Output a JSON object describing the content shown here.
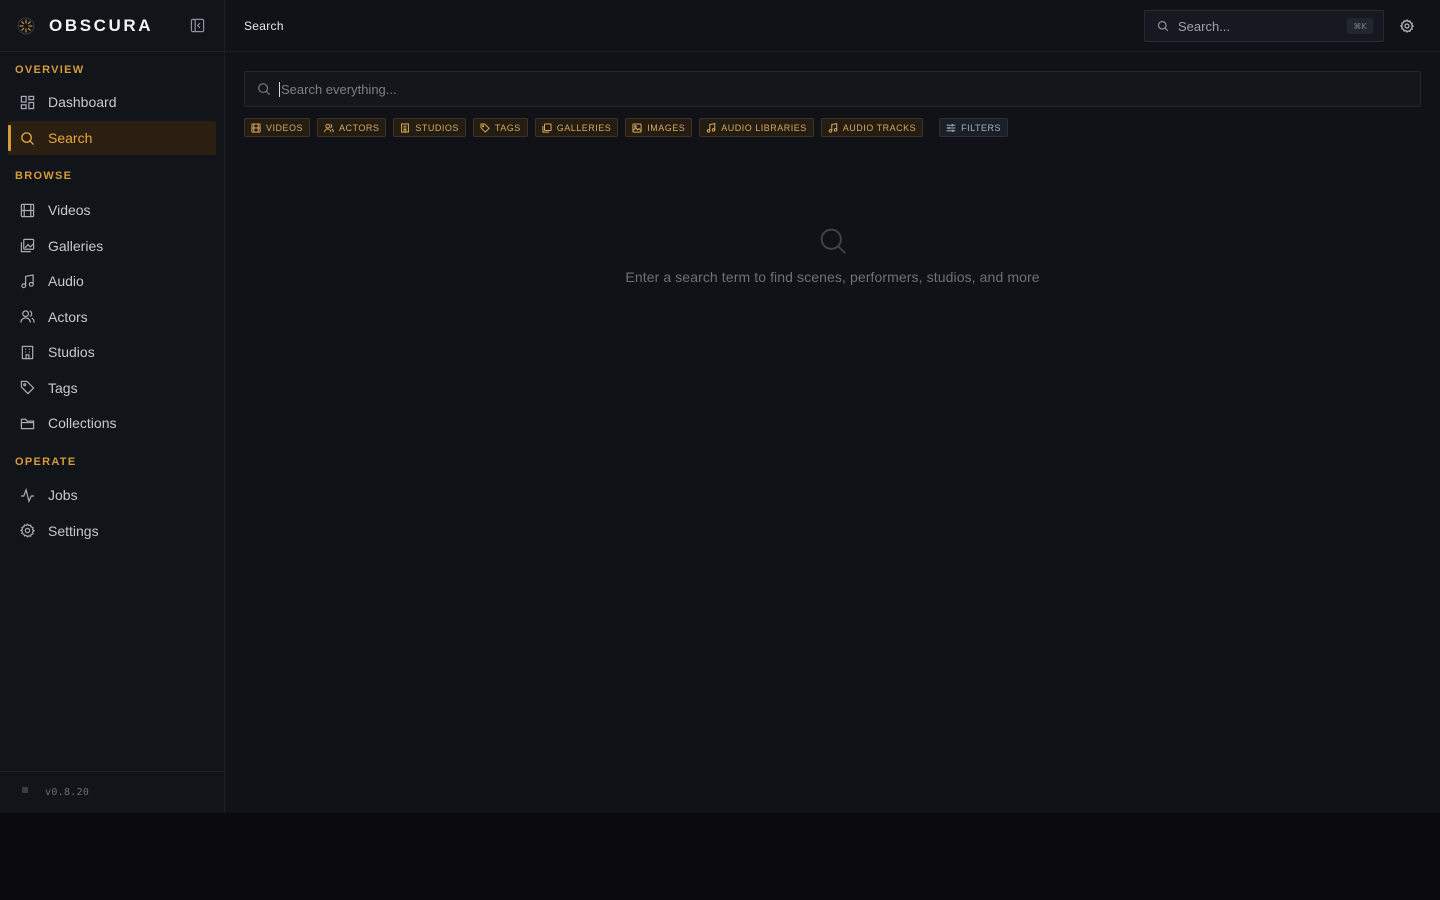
{
  "app": {
    "name": "OBSCURA",
    "version": "v0.8.20"
  },
  "colors": {
    "accent": "#d49a3c",
    "background": "#101217",
    "sidebar": "#111419"
  },
  "sidebar": {
    "sections": [
      {
        "label": "OVERVIEW",
        "items": [
          {
            "label": "Dashboard",
            "icon": "dashboard-icon"
          },
          {
            "label": "Search",
            "icon": "search-icon",
            "active": true
          }
        ]
      },
      {
        "label": "BROWSE",
        "items": [
          {
            "label": "Videos",
            "icon": "film-icon"
          },
          {
            "label": "Galleries",
            "icon": "gallery-icon"
          },
          {
            "label": "Audio",
            "icon": "music-icon"
          },
          {
            "label": "Actors",
            "icon": "users-icon"
          },
          {
            "label": "Studios",
            "icon": "building-icon"
          },
          {
            "label": "Tags",
            "icon": "tag-icon"
          },
          {
            "label": "Collections",
            "icon": "folder-icon"
          }
        ]
      },
      {
        "label": "OPERATE",
        "items": [
          {
            "label": "Jobs",
            "icon": "activity-icon"
          },
          {
            "label": "Settings",
            "icon": "gear-icon"
          }
        ]
      }
    ]
  },
  "topbar": {
    "breadcrumb": "Search",
    "search_placeholder": "Search...",
    "shortcut": "⌘K"
  },
  "main": {
    "search_placeholder": "Search everything...",
    "chips": [
      {
        "label": "VIDEOS",
        "icon": "film-icon"
      },
      {
        "label": "ACTORS",
        "icon": "users-icon"
      },
      {
        "label": "STUDIOS",
        "icon": "building-icon"
      },
      {
        "label": "TAGS",
        "icon": "tag-icon"
      },
      {
        "label": "GALLERIES",
        "icon": "gallery-icon"
      },
      {
        "label": "IMAGES",
        "icon": "image-icon"
      },
      {
        "label": "AUDIO LIBRARIES",
        "icon": "music-icon"
      },
      {
        "label": "AUDIO TRACKS",
        "icon": "music-icon"
      }
    ],
    "filters_label": "FILTERS",
    "empty_state": "Enter a search term to find scenes, performers, studios, and more"
  }
}
